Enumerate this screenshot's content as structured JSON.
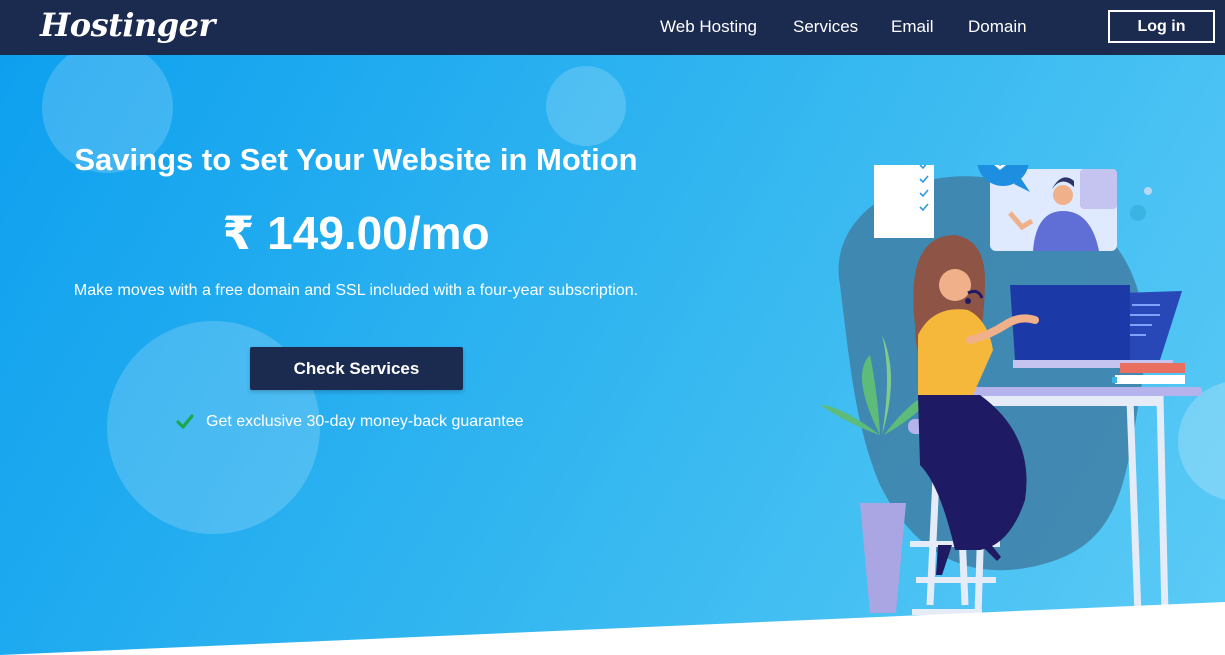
{
  "header": {
    "logo": "Hostinger",
    "menu": [
      "Web Hosting",
      "Services",
      "Email",
      "Domain"
    ],
    "login_label": "Log in"
  },
  "hero": {
    "title": "Savings to Set Your Website in Motion",
    "price": "₹ 149.00/mo",
    "subtitle": "Make moves with a free domain and SSL included with a four-year subscription.",
    "cta_label": "Check Services",
    "guarantee": "Get exclusive 30-day money-back guarantee"
  },
  "colors": {
    "nav_bg": "#1b2a4f",
    "hero_gradient_start": "#0ea0ef",
    "hero_gradient_end": "#5ccbf6",
    "cta_bg": "#1b2a4f",
    "check": "#1ca84a"
  },
  "icons": [
    "check-icon",
    "support-person-illustration",
    "chat-bubble-icon"
  ]
}
